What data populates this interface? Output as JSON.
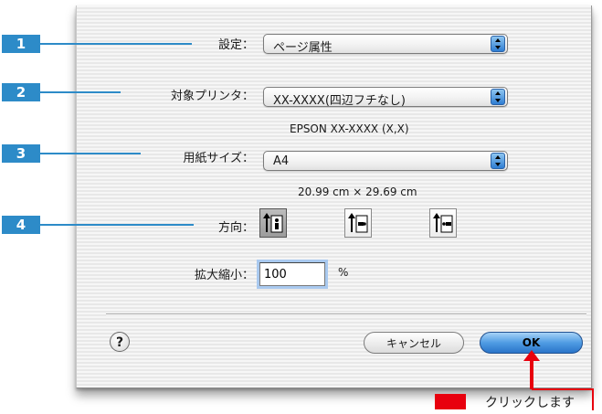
{
  "callouts": [
    "1",
    "2",
    "3",
    "4"
  ],
  "settings": {
    "label": "設定：",
    "value": "ページ属性"
  },
  "printer": {
    "label": "対象プリンタ：",
    "value": "XX-XXXX(四辺フチなし)",
    "subtext": "EPSON XX-XXXX (X,X)"
  },
  "paper": {
    "label": "用紙サイズ：",
    "value": "A4",
    "subtext": "20.99 cm × 29.69 cm"
  },
  "orientation": {
    "label": "方向：",
    "options": [
      "portrait-icon",
      "landscape-left-icon",
      "landscape-right-icon"
    ],
    "selected_index": 0
  },
  "scale": {
    "label": "拡大縮小：",
    "value": "100",
    "unit": "%"
  },
  "buttons": {
    "help": "?",
    "cancel": "キャンセル",
    "ok": "OK"
  },
  "annotation": {
    "text": "クリックします",
    "color": "#e8000e"
  },
  "accent_colors": {
    "callout": "#2d8bc8",
    "ok_button": "#4f9ce3"
  }
}
